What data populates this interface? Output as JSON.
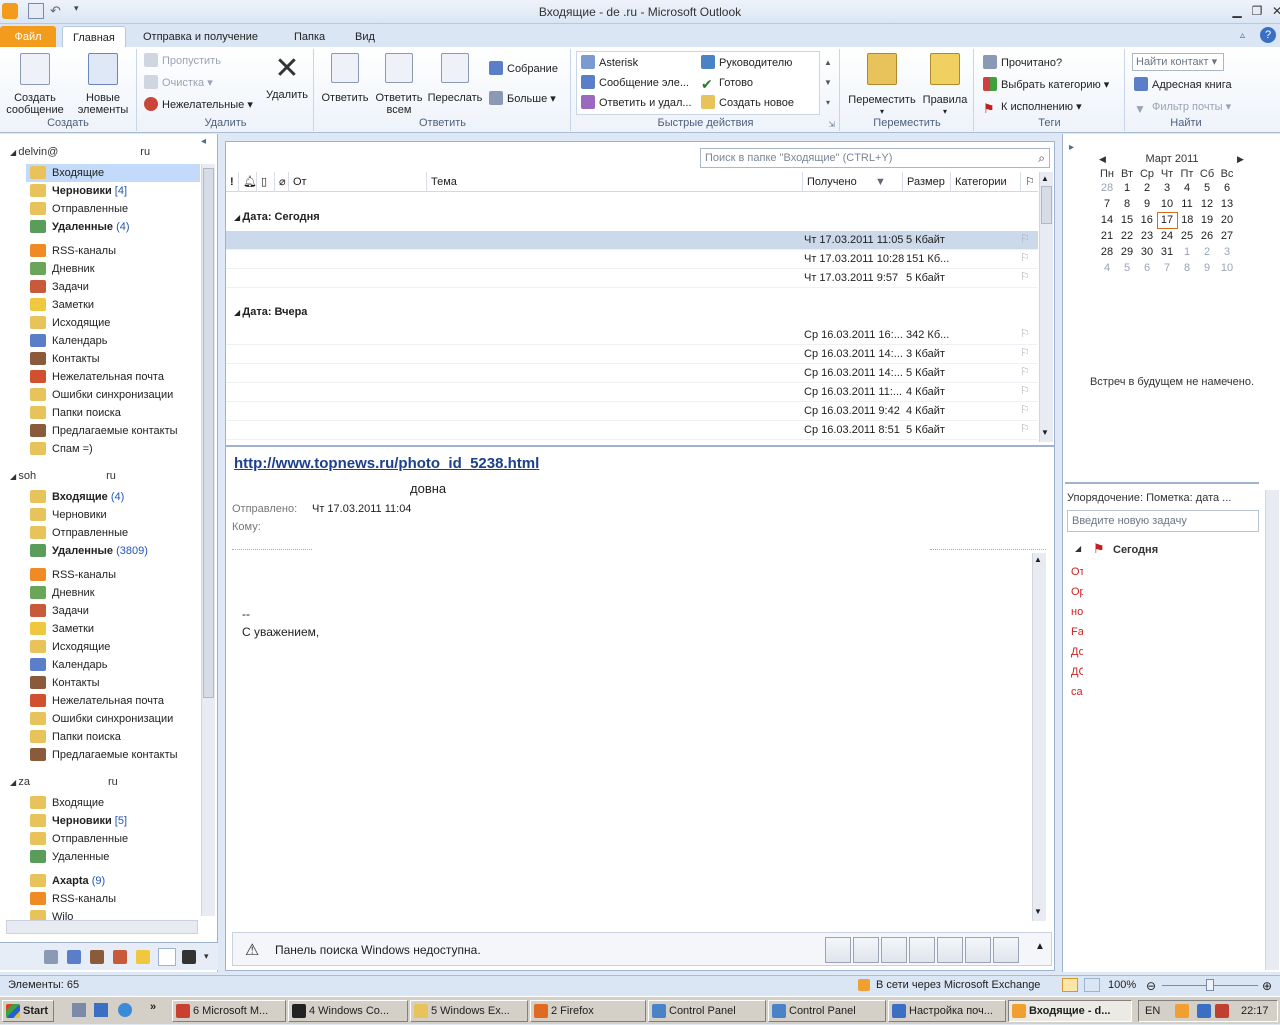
{
  "window": {
    "title": "Входящие - de            .ru - Microsoft Outlook"
  },
  "tabs": [
    {
      "label": "Файл"
    },
    {
      "label": "Главная"
    },
    {
      "label": "Отправка и получение"
    },
    {
      "label": "Папка"
    },
    {
      "label": "Вид"
    }
  ],
  "ribbon": {
    "create": {
      "new_message": "Создать\nсообщение",
      "new_items": "Новые\nэлементы",
      "label": "Создать"
    },
    "delete": {
      "ignore": "Пропустить",
      "clean": "Очистка",
      "junk": "Нежелательные",
      "delete": "Удалить",
      "label": "Удалить"
    },
    "respond": {
      "reply": "Ответить",
      "reply_all": "Ответить\nвсем",
      "forward": "Переслать",
      "meeting": "Собрание",
      "more": "Больше",
      "label": "Ответить"
    },
    "quick": {
      "items": [
        "Asterisk",
        "Сообщение эле...",
        "Ответить и удал...",
        "Руководителю",
        "Готово",
        "Создать новое"
      ],
      "label": "Быстрые действия"
    },
    "move": {
      "move": "Переместить",
      "rules": "Правила",
      "label": "Переместить"
    },
    "tags": {
      "read": "Прочитано?",
      "category": "Выбрать категорию",
      "followup": "К исполнению",
      "label": "Теги"
    },
    "find": {
      "contact": "Найти контакт",
      "addressbook": "Адресная книга",
      "filter": "Фильтр почты",
      "label": "Найти"
    }
  },
  "nav": {
    "accounts": [
      {
        "name_a": "delvin@",
        "name_b": "ru",
        "folders": [
          {
            "label": "Входящие",
            "count": "",
            "bold": false,
            "sel": true,
            "color": "#e8c25a"
          },
          {
            "label": "Черновики",
            "count": "[4]",
            "bold": true,
            "color": "#e8c25a"
          },
          {
            "label": "Отправленные",
            "count": "",
            "bold": false,
            "color": "#e8c25a"
          },
          {
            "label": "Удаленные",
            "count": "(4)",
            "bold": true,
            "color": "#5a9c5a"
          },
          {
            "label": "RSS-каналы",
            "count": "",
            "bold": false,
            "color": "#f08a24"
          },
          {
            "label": "Дневник",
            "count": "",
            "bold": false,
            "color": "#6aa55a"
          },
          {
            "label": "Задачи",
            "count": "",
            "bold": false,
            "color": "#c85a3a"
          },
          {
            "label": "Заметки",
            "count": "",
            "bold": false,
            "color": "#f0c840"
          },
          {
            "label": "Исходящие",
            "count": "",
            "bold": false,
            "color": "#e8c25a"
          },
          {
            "label": "Календарь",
            "count": "",
            "bold": false,
            "color": "#5a7fc8"
          },
          {
            "label": "Контакты",
            "count": "",
            "bold": false,
            "color": "#8a5a3a"
          },
          {
            "label": "Нежелательная почта",
            "count": "",
            "bold": false,
            "color": "#d05030"
          },
          {
            "label": "Ошибки синхронизации",
            "count": "",
            "bold": false,
            "color": "#e8c25a"
          },
          {
            "label": "Папки поиска",
            "count": "",
            "bold": false,
            "color": "#e8c25a"
          },
          {
            "label": "Предлагаемые контакты",
            "count": "",
            "bold": false,
            "color": "#8a5a3a"
          },
          {
            "label": "Спам =)",
            "count": "",
            "bold": false,
            "color": "#e8c25a"
          }
        ]
      },
      {
        "name_a": "soh",
        "name_b": "ru",
        "folders": [
          {
            "label": "Входящие",
            "count": "(4)",
            "bold": true,
            "color": "#e8c25a"
          },
          {
            "label": "Черновики",
            "count": "",
            "bold": false,
            "color": "#e8c25a"
          },
          {
            "label": "Отправленные",
            "count": "",
            "bold": false,
            "color": "#e8c25a"
          },
          {
            "label": "Удаленные",
            "count": "(3809)",
            "bold": true,
            "color": "#5a9c5a"
          },
          {
            "label": "RSS-каналы",
            "count": "",
            "bold": false,
            "color": "#f08a24"
          },
          {
            "label": "Дневник",
            "count": "",
            "bold": false,
            "color": "#6aa55a"
          },
          {
            "label": "Задачи",
            "count": "",
            "bold": false,
            "color": "#c85a3a"
          },
          {
            "label": "Заметки",
            "count": "",
            "bold": false,
            "color": "#f0c840"
          },
          {
            "label": "Исходящие",
            "count": "",
            "bold": false,
            "color": "#e8c25a"
          },
          {
            "label": "Календарь",
            "count": "",
            "bold": false,
            "color": "#5a7fc8"
          },
          {
            "label": "Контакты",
            "count": "",
            "bold": false,
            "color": "#8a5a3a"
          },
          {
            "label": "Нежелательная почта",
            "count": "",
            "bold": false,
            "color": "#d05030"
          },
          {
            "label": "Ошибки синхронизации",
            "count": "",
            "bold": false,
            "color": "#e8c25a"
          },
          {
            "label": "Папки поиска",
            "count": "",
            "bold": false,
            "color": "#e8c25a"
          },
          {
            "label": "Предлагаемые контакты",
            "count": "",
            "bold": false,
            "color": "#8a5a3a"
          }
        ]
      },
      {
        "name_a": "za",
        "name_b": "ru",
        "folders": [
          {
            "label": "Входящие",
            "count": "",
            "bold": false,
            "color": "#e8c25a"
          },
          {
            "label": "Черновики",
            "count": "[5]",
            "bold": true,
            "color": "#e8c25a"
          },
          {
            "label": "Отправленные",
            "count": "",
            "bold": false,
            "color": "#e8c25a"
          },
          {
            "label": "Удаленные",
            "count": "",
            "bold": false,
            "color": "#5a9c5a"
          },
          {
            "label": "Axapta",
            "count": "(9)",
            "bold": true,
            "color": "#e8c25a"
          },
          {
            "label": "RSS-каналы",
            "count": "",
            "bold": false,
            "color": "#f08a24"
          },
          {
            "label": "Wilo",
            "count": "",
            "bold": false,
            "color": "#e8c25a"
          }
        ]
      }
    ]
  },
  "mail": {
    "search_placeholder": "Поиск в папке \"Входящие\" (CTRL+Y)",
    "columns": {
      "from": "От",
      "subject": "Тема",
      "received": "Получено",
      "size": "Размер",
      "categories": "Категории"
    },
    "groups": [
      {
        "label": "Дата: Сегодня",
        "rows": [
          {
            "received": "Чт 17.03.2011 11:05",
            "size": "5 Кбайт",
            "sel": true
          },
          {
            "received": "Чт 17.03.2011 10:28",
            "size": "151 Кб..."
          },
          {
            "received": "Чт 17.03.2011 9:57",
            "size": "5 Кбайт"
          }
        ]
      },
      {
        "label": "Дата: Вчера",
        "rows": [
          {
            "received": "Ср 16.03.2011 16:...",
            "size": "342 Кб..."
          },
          {
            "received": "Ср 16.03.2011 14:...",
            "size": "3 Кбайт"
          },
          {
            "received": "Ср 16.03.2011 14:...",
            "size": "5 Кбайт"
          },
          {
            "received": "Ср 16.03.2011 11:...",
            "size": "4 Кбайт"
          },
          {
            "received": "Ср 16.03.2011 9:42",
            "size": "4 Кбайт"
          },
          {
            "received": "Ср 16.03.2011 8:51",
            "size": "5 Кбайт"
          }
        ]
      }
    ]
  },
  "preview": {
    "link": "http://www.topnews.ru/photo_id_5238.html",
    "from_tail": "довна",
    "sent_label": "Отправлено:",
    "sent_value": "Чт 17.03.2011 11:04",
    "to_label": "Кому:",
    "body_sig1": "--",
    "body_sig2": "С уважением,"
  },
  "search_warning": "Панель поиска Windows недоступна.",
  "calendar": {
    "month": "Март 2011",
    "days": [
      "Пн",
      "Вт",
      "Ср",
      "Чт",
      "Пт",
      "Сб",
      "Вс"
    ],
    "weeks": [
      [
        "28",
        "1",
        "2",
        "3",
        "4",
        "5",
        "6"
      ],
      [
        "7",
        "8",
        "9",
        "10",
        "11",
        "12",
        "13"
      ],
      [
        "14",
        "15",
        "16",
        "17",
        "18",
        "19",
        "20"
      ],
      [
        "21",
        "22",
        "23",
        "24",
        "25",
        "26",
        "27"
      ],
      [
        "28",
        "29",
        "30",
        "31",
        "1",
        "2",
        "3"
      ],
      [
        "4",
        "5",
        "6",
        "7",
        "8",
        "9",
        "10"
      ]
    ],
    "no_meetings": "Встреч в будущем не намечено."
  },
  "tasks": {
    "arrange": "Упорядочение: Пометка: дата ...",
    "new_task": "Введите новую задачу",
    "today": "Сегодня",
    "items": [
      "От",
      "Ор",
      "но",
      "Fa",
      "До",
      "ДС",
      "са"
    ]
  },
  "status": {
    "items": "Элементы: 65",
    "connection": "В сети через Microsoft Exchange",
    "zoom": "100%"
  },
  "taskbar": {
    "start": "Start",
    "buttons": [
      "6 Microsoft M...",
      "4 Windows Co...",
      "5 Windows Ex...",
      "2 Firefox",
      "Control Panel",
      "Control Panel",
      "Настройка поч...",
      "Входящие - d..."
    ],
    "lang": "EN",
    "time": "22:17"
  }
}
